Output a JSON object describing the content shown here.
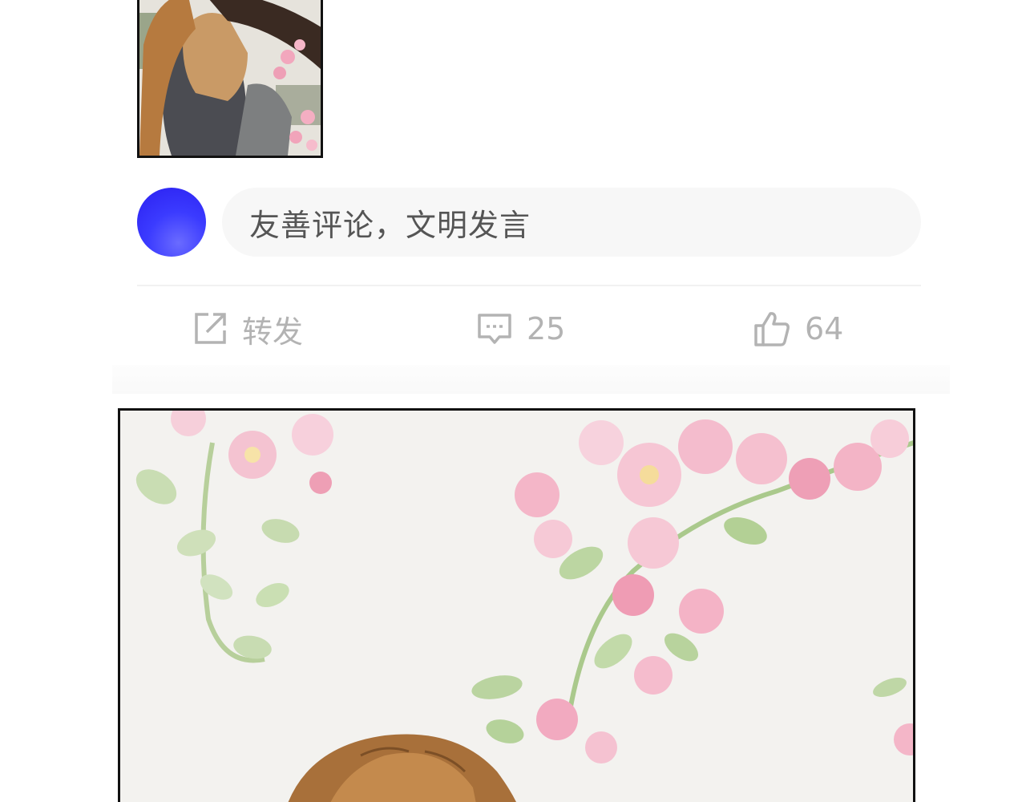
{
  "comment": {
    "placeholder": "友善评论，文明发言"
  },
  "actions": {
    "share_label": "转发",
    "comment_count": "25",
    "like_count": "64"
  },
  "colors": {
    "avatar": "#3b3bff",
    "icon_gray": "#b3b3b3",
    "input_bg": "#f7f7f7"
  },
  "icons": [
    "share-icon",
    "comment-icon",
    "like-icon"
  ]
}
